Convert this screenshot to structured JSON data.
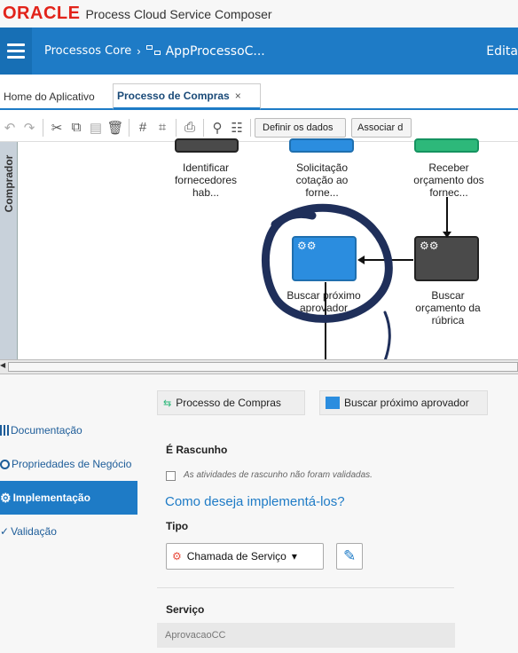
{
  "header": {
    "oracle_logo": "ORACLE",
    "product": "Process Cloud Service Composer"
  },
  "nav": {
    "crumb_core": "Processos Core",
    "separator": "›",
    "app_title": "AppProcessoC...",
    "edit_label": "Edita"
  },
  "tabs": [
    {
      "label": "Home do Aplicativo"
    },
    {
      "label": "Processo de Compras",
      "close": "×"
    }
  ],
  "toolbar": {
    "define_data": "Definir os dados",
    "associate": "Associar d"
  },
  "canvas": {
    "lane": "Comprador",
    "nodes": [
      {
        "label": "Identificar fornecedores hab...",
        "lines": [
          "Identificar",
          "fornecedores",
          "hab..."
        ]
      },
      {
        "label": "Solicitação cotação ao forne...",
        "lines": [
          "Solicitação",
          "cotação ao",
          "forne..."
        ]
      },
      {
        "label": "Receber orçamento dos fornec...",
        "lines": [
          "Receber",
          "orçamento dos",
          "fornec..."
        ]
      },
      {
        "label": "Buscar próximo aprovador",
        "lines": [
          "Buscar próximo",
          "aprovador"
        ]
      },
      {
        "label": "Buscar orçamento da rúbrica",
        "lines": [
          "Buscar",
          "orçamento da",
          "rúbrica"
        ]
      }
    ],
    "colors": {
      "blue_task": "#2b8ddf",
      "green_task": "#2db87a",
      "gray_task": "#4a4a4a",
      "annotation": "#1f2f5a"
    }
  },
  "side_nav": [
    {
      "label": "Documentação",
      "icon": "documentation-icon",
      "active": false
    },
    {
      "label": "Propriedades de Negócio",
      "icon": "business-properties-icon",
      "active": false
    },
    {
      "label": "Implementação",
      "icon": "gears-icon",
      "active": true
    },
    {
      "label": "Validação",
      "icon": "check-icon",
      "active": false
    }
  ],
  "properties": {
    "context_process": "Processo de Compras",
    "context_activity": "Buscar próximo aprovador",
    "draft_title": "É Rascunho",
    "draft_hint": "As atividades de rascunho não foram validadas.",
    "question": "Como deseja implementá-los?",
    "type_title": "Tipo",
    "type_value": "Chamada de Serviço",
    "service_title": "Serviço",
    "service_value": "AprovacaoCC"
  }
}
